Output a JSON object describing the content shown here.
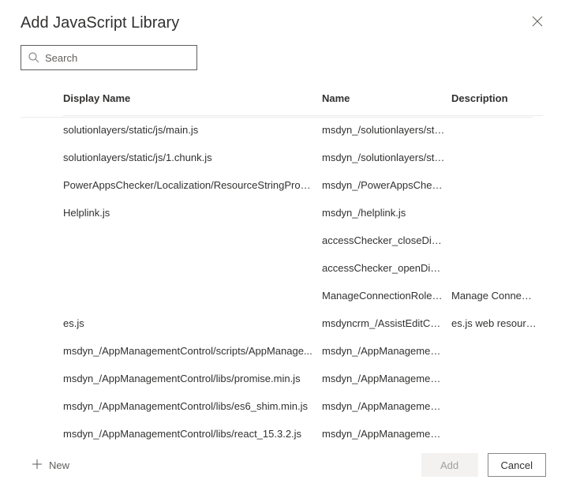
{
  "dialog": {
    "title": "Add JavaScript Library"
  },
  "search": {
    "placeholder": "Search"
  },
  "table": {
    "headers": {
      "display_name": "Display Name",
      "name": "Name",
      "description": "Description"
    },
    "rows": [
      {
        "display_name": "solutionlayers/static/js/main.js",
        "name": "msdyn_/solutionlayers/sta...",
        "description": ""
      },
      {
        "display_name": "solutionlayers/static/js/1.chunk.js",
        "name": "msdyn_/solutionlayers/sta...",
        "description": ""
      },
      {
        "display_name": "PowerAppsChecker/Localization/ResourceStringProvid...",
        "name": "msdyn_/PowerAppsCheck...",
        "description": ""
      },
      {
        "display_name": "Helplink.js",
        "name": "msdyn_/helplink.js",
        "description": ""
      },
      {
        "display_name": "",
        "name": "accessChecker_closeDialo...",
        "description": ""
      },
      {
        "display_name": "",
        "name": "accessChecker_openDialo...",
        "description": ""
      },
      {
        "display_name": "",
        "name": "ManageConnectionRoles...",
        "description": "Manage Connect..."
      },
      {
        "display_name": "es.js",
        "name": "msdyncrm_/AssistEditCon...",
        "description": "es.js web resource."
      },
      {
        "display_name": "msdyn_/AppManagementControl/scripts/AppManage...",
        "name": "msdyn_/AppManagement...",
        "description": ""
      },
      {
        "display_name": "msdyn_/AppManagementControl/libs/promise.min.js",
        "name": "msdyn_/AppManagement...",
        "description": ""
      },
      {
        "display_name": "msdyn_/AppManagementControl/libs/es6_shim.min.js",
        "name": "msdyn_/AppManagement...",
        "description": ""
      },
      {
        "display_name": "msdyn_/AppManagementControl/libs/react_15.3.2.js",
        "name": "msdyn_/AppManagement...",
        "description": ""
      }
    ]
  },
  "footer": {
    "new_label": "New",
    "add_label": "Add",
    "cancel_label": "Cancel"
  }
}
